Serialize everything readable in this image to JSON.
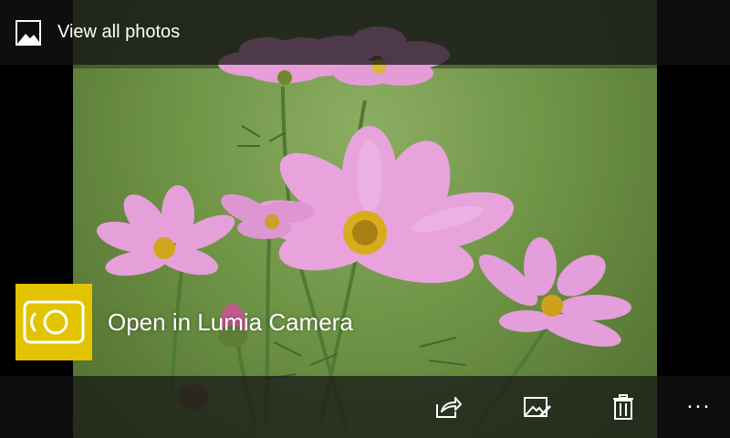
{
  "top_bar": {
    "title": "View all photos",
    "icon": "photos-icon"
  },
  "camera_tile": {
    "label": "Open in Lumia Camera",
    "icon": "lumia-camera-icon",
    "color": "#e2c300"
  },
  "app_bar": {
    "buttons": [
      {
        "name": "share",
        "icon": "share-icon"
      },
      {
        "name": "edit",
        "icon": "edit-photo-icon"
      },
      {
        "name": "delete",
        "icon": "trash-icon"
      }
    ],
    "more": {
      "label": "...",
      "icon": "more-icon"
    }
  },
  "photo": {
    "subject": "pink-cosmos-flowers",
    "background_color": "#6f9446"
  }
}
